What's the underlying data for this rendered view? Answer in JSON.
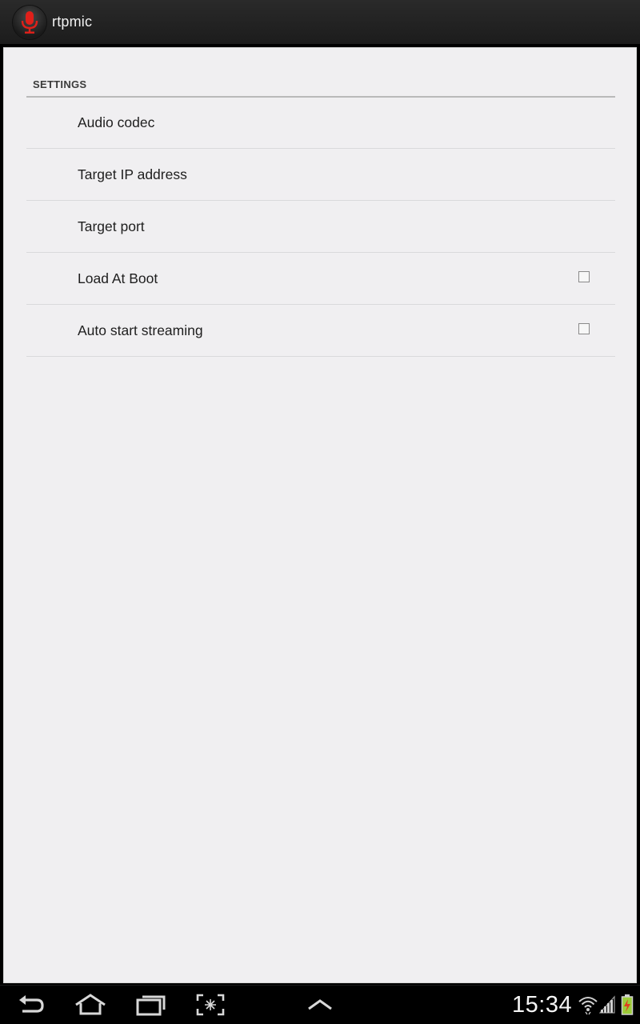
{
  "app": {
    "title": "rtpmic",
    "icon": "microphone-icon"
  },
  "settings": {
    "header": "SETTINGS",
    "items": [
      {
        "title": "Audio codec",
        "has_checkbox": false
      },
      {
        "title": "Target IP address",
        "has_checkbox": false
      },
      {
        "title": "Target port",
        "has_checkbox": false
      },
      {
        "title": "Load At Boot",
        "has_checkbox": true,
        "checked": false
      },
      {
        "title": "Auto start streaming",
        "has_checkbox": true,
        "checked": false
      }
    ]
  },
  "system_bar": {
    "buttons": [
      "back-icon",
      "home-icon",
      "recent-apps-icon",
      "screenshot-icon",
      "menu-up-icon"
    ],
    "clock": "15:34",
    "status_icons": [
      "wifi-icon",
      "signal-icon",
      "battery-icon"
    ]
  },
  "colors": {
    "accent_red": "#e0201a",
    "background": "#f0eff1",
    "battery_green": "#9ccc3a"
  }
}
